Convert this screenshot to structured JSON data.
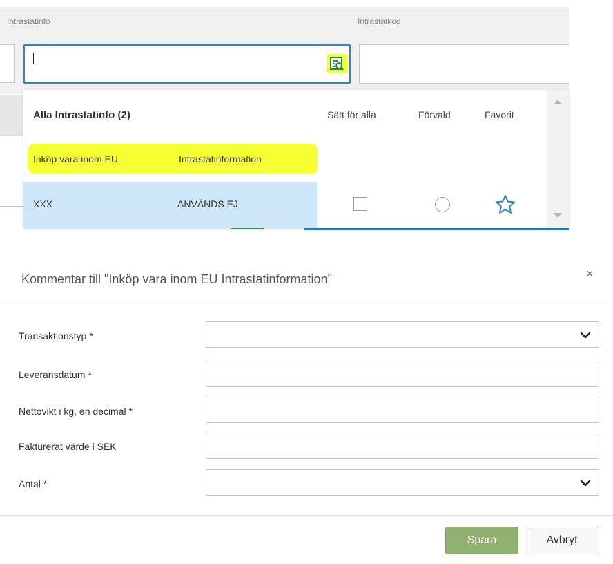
{
  "top": {
    "columns": {
      "intrastatinfo_label": "Intrastatinfo",
      "intrastatkod_label": "Intrastatkod"
    },
    "intrastatinfo_value": "",
    "intrastatkod_value": ""
  },
  "dropdown": {
    "title": "Alla Intrastatinfo (2)",
    "columns": [
      "Sätt för alla",
      "Förvald",
      "Favorit"
    ],
    "subheader": [
      "Inköp vara inom EU",
      "Intrastatinformation"
    ],
    "rows": [
      {
        "code": "XXX",
        "text": "ANVÄNDS EJ",
        "set_all": false,
        "default": false,
        "favorite": false
      }
    ]
  },
  "modal": {
    "title": "Kommentar till \"Inköp vara inom EU Intrastatinformation\"",
    "close_glyph": "×",
    "fields": [
      {
        "label": "Transaktionstyp *",
        "type": "select",
        "value": ""
      },
      {
        "label": "Leveransdatum *",
        "type": "text",
        "value": ""
      },
      {
        "label": "Nettovikt i kg, en decimal *",
        "type": "text",
        "value": ""
      },
      {
        "label": "Fakturerat värde i SEK",
        "type": "text",
        "value": ""
      },
      {
        "label": "Antal *",
        "type": "select",
        "value": ""
      }
    ],
    "save_label": "Spara",
    "cancel_label": "Avbryt"
  },
  "colors": {
    "accent_blue": "#2e86c8",
    "highlight_yellow": "#f6ff33",
    "selected_row": "#cfe8f9",
    "save_green": "#8fb06f"
  },
  "icons": [
    "lookup-icon",
    "star-icon",
    "close-icon",
    "chevron-down-icon"
  ]
}
